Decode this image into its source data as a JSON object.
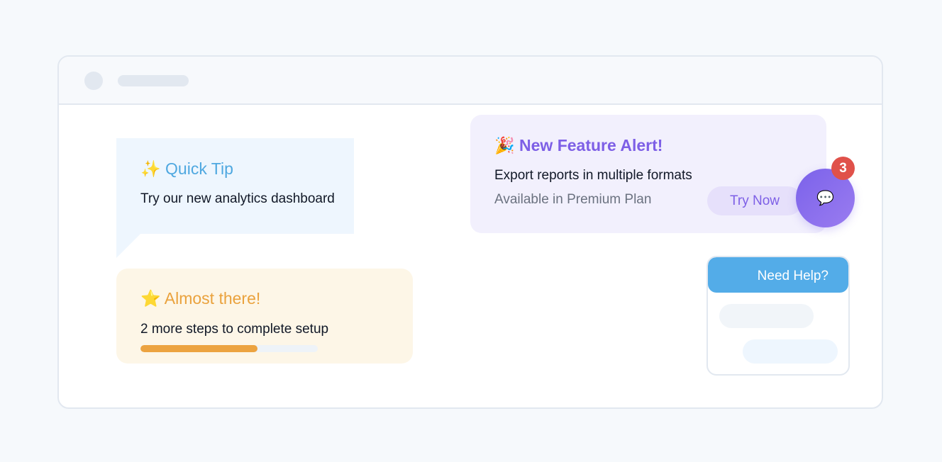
{
  "window": {
    "titlebar": {
      "dot": "placeholder-avatar",
      "title_placeholder": "skeleton-bar"
    }
  },
  "quick_tip": {
    "icon": "✨",
    "icon_name": "sparkles-icon",
    "title": "Quick Tip",
    "body": "Try our new analytics dashboard",
    "accent_color": "#4fa8e0"
  },
  "almost_there": {
    "icon": "⭐",
    "icon_name": "star-icon",
    "title": "Almost there!",
    "body": "2 more steps to complete setup",
    "progress_percent": 66,
    "accent_color": "#eca340"
  },
  "feature_alert": {
    "icon": "🎉",
    "icon_name": "party-popper-icon",
    "title": "New Feature Alert!",
    "body": "Export reports in multiple formats",
    "subtext": "Available in Premium Plan",
    "button_label": "Try Now",
    "accent_color": "#7d5fe6"
  },
  "chat_fab": {
    "icon": "💬",
    "icon_name": "speech-bubble-icon",
    "badge_count": "3",
    "badge_color": "#e0514a"
  },
  "help_widget": {
    "title": "Need Help?",
    "header_color": "#53ace8"
  }
}
